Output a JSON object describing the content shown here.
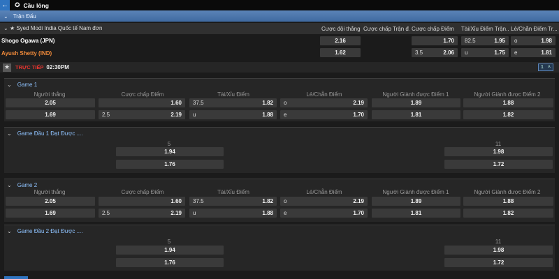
{
  "topbar": {
    "back_icon": "arrow-left-icon",
    "sport_icon": "shuttlecock-icon",
    "title": "Cầu lông"
  },
  "section": {
    "title": "Trận Đấu"
  },
  "league": {
    "name": "Syed Modi India Quốc tế Nam đơn",
    "columns": [
      "Cược đội thắng",
      "Cược chấp Trận đ...",
      "Cược chấp Điểm",
      "Tài/Xỉu Điểm Trận...",
      "Lẻ/Chẵn Điểm Tr..."
    ]
  },
  "teams": {
    "team1": "Shogo Ogawa (JPN)",
    "team2": "Ayush Shetty (IND)"
  },
  "match_odds": {
    "winner": [
      "2.16",
      "1.62"
    ],
    "point_handicap": [
      {
        "line": "",
        "odd": "1.70"
      },
      {
        "line": "3.5",
        "odd": "2.06"
      }
    ],
    "total": [
      {
        "line": "82.5",
        "odd": "1.95"
      },
      {
        "line": "u",
        "odd": "1.75"
      }
    ],
    "odd_even": [
      {
        "line": "o",
        "odd": "1.98"
      },
      {
        "line": "e",
        "odd": "1.81"
      }
    ]
  },
  "live": {
    "label": "TRỰC TIẾP",
    "time": "02:30PM",
    "count": "1"
  },
  "game1": {
    "title": "Game 1",
    "headers": [
      "Người thắng",
      "Cược chấp Điểm",
      "Tài/Xỉu Điểm",
      "Lẻ/Chẵn Điểm",
      "Người Giành được Điểm 1",
      "Người Giành được Điểm 2"
    ],
    "row1": {
      "c1": "2.05",
      "c2": "1.60",
      "c3l": "37.5",
      "c3": "1.82",
      "c4l": "o",
      "c4": "2.19",
      "c5": "1.89",
      "c6": "1.88"
    },
    "row2": {
      "c1": "1.69",
      "c2l": "2.5",
      "c2": "2.19",
      "c3l": "u",
      "c3": "1.88",
      "c4l": "e",
      "c4": "1.70",
      "c5": "1.81",
      "c6": "1.82"
    }
  },
  "game1_race": {
    "title": "Game Đầu 1 Đạt Được ....",
    "left_header": "5",
    "right_header": "11",
    "left": [
      "1.94",
      "1.76"
    ],
    "right": [
      "1.98",
      "1.72"
    ]
  },
  "game2": {
    "title": "Game 2",
    "headers": [
      "Người thắng",
      "Cược chấp Điểm",
      "Tài/Xỉu Điểm",
      "Lẻ/Chẵn Điểm",
      "Người Giành được Điểm 1",
      "Người Giành được Điểm 2"
    ],
    "row1": {
      "c1": "2.05",
      "c2": "1.60",
      "c3l": "37.5",
      "c3": "1.82",
      "c4l": "o",
      "c4": "2.19",
      "c5": "1.89",
      "c6": "1.88"
    },
    "row2": {
      "c1": "1.69",
      "c2l": "2.5",
      "c2": "2.19",
      "c3l": "u",
      "c3": "1.88",
      "c4l": "e",
      "c4": "1.70",
      "c5": "1.81",
      "c6": "1.82"
    }
  },
  "game2_race": {
    "title": "Game Đầu 2 Đạt Được ....",
    "left_header": "5",
    "right_header": "11",
    "left": [
      "1.94",
      "1.76"
    ],
    "right": [
      "1.98",
      "1.72"
    ]
  }
}
